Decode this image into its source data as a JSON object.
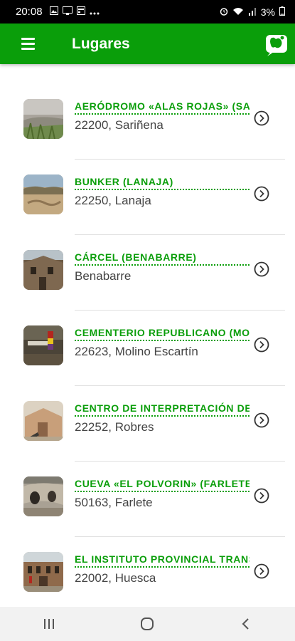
{
  "status_bar": {
    "time": "20:08",
    "battery": "3%"
  },
  "app_bar": {
    "title": "Lugares",
    "color": "#0a9e0a"
  },
  "places": [
    {
      "name": "AERÓDROMO «ALAS ROJAS» (SAR",
      "location": "22200, Sariñena"
    },
    {
      "name": "BUNKER (LANAJA)",
      "location": "22250, Lanaja"
    },
    {
      "name": "CÁRCEL (BENABARRE)",
      "location": "Benabarre"
    },
    {
      "name": "CEMENTERIO REPUBLICANO (MOL",
      "location": "22623, Molino Escartín"
    },
    {
      "name": "CENTRO DE INTERPRETACIÓN DE L",
      "location": "22252, Robres"
    },
    {
      "name": "CUEVA «EL POLVORIN» (FARLETE)",
      "location": "50163, Farlete"
    },
    {
      "name": "EL INSTITUTO PROVINCIAL TRANS",
      "location": "22002, Huesca"
    }
  ]
}
